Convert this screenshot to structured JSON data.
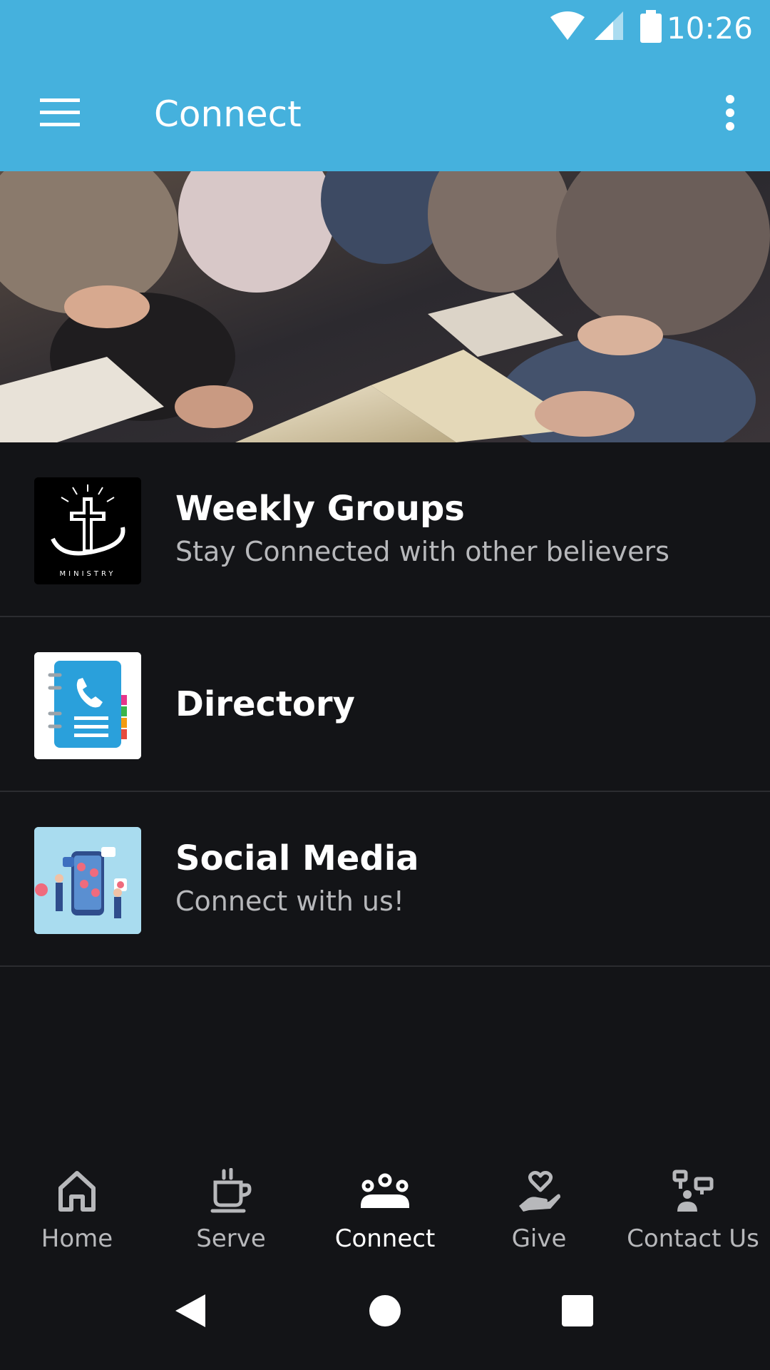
{
  "status_bar": {
    "time": "10:26",
    "icons": [
      "wifi-icon",
      "cell-signal-icon",
      "battery-icon"
    ]
  },
  "app_bar": {
    "title": "Connect",
    "menu_icon": "hamburger-menu-icon",
    "overflow_icon": "more-vertical-icon"
  },
  "list": {
    "items": [
      {
        "title": "Weekly Groups",
        "subtitle": "Stay Connected with other believers",
        "thumb_icon": "ministry-cross-logo",
        "thumb_text": "MINISTRY"
      },
      {
        "title": "Directory",
        "subtitle": "",
        "thumb_icon": "phone-book-icon"
      },
      {
        "title": "Social Media",
        "subtitle": "Connect with us!",
        "thumb_icon": "social-media-illustration"
      }
    ]
  },
  "bottom_nav": {
    "items": [
      {
        "label": "Home",
        "icon": "home-icon",
        "active": false
      },
      {
        "label": "Serve",
        "icon": "coffee-cup-icon",
        "active": false
      },
      {
        "label": "Connect",
        "icon": "group-icon",
        "active": true
      },
      {
        "label": "Give",
        "icon": "heart-hand-icon",
        "active": false
      },
      {
        "label": "Contact Us",
        "icon": "contact-person-icon",
        "active": false
      }
    ]
  },
  "system_nav": {
    "icons": [
      "back-icon",
      "home-circle-icon",
      "recents-icon"
    ]
  },
  "colors": {
    "primary": "#45b1dd",
    "background": "#131417",
    "divider": "#2b2c30",
    "text_primary": "#ffffff",
    "text_secondary": "#b7b8bb"
  }
}
